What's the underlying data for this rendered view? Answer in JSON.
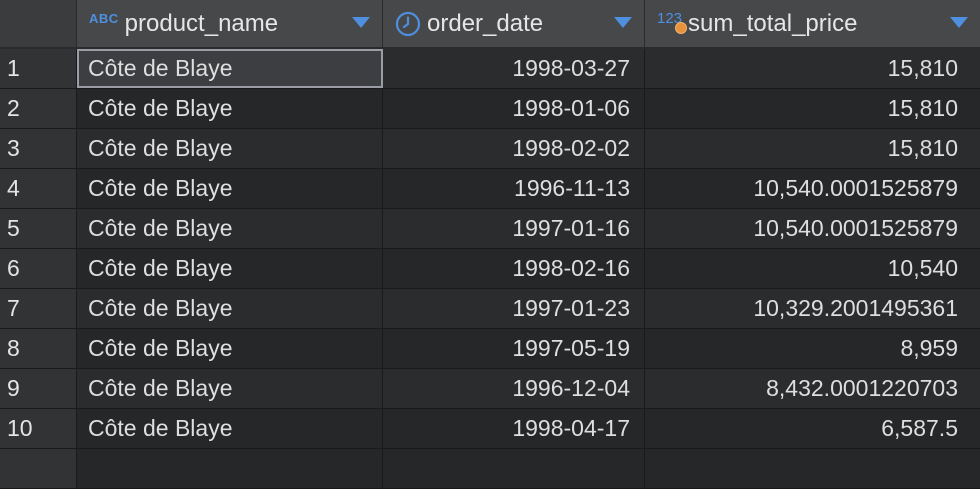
{
  "columns": [
    {
      "name": "product_name",
      "type_icon": "ABC",
      "icon_name": "text-type-icon"
    },
    {
      "name": "order_date",
      "type_icon": "",
      "icon_name": "clock-icon"
    },
    {
      "name": "sum_total_price",
      "type_icon": "123",
      "icon_name": "number-type-icon"
    }
  ],
  "rows": [
    {
      "n": "1",
      "product_name": "Côte de Blaye",
      "order_date": "1998-03-27",
      "sum_total_price": "15,810"
    },
    {
      "n": "2",
      "product_name": "Côte de Blaye",
      "order_date": "1998-01-06",
      "sum_total_price": "15,810"
    },
    {
      "n": "3",
      "product_name": "Côte de Blaye",
      "order_date": "1998-02-02",
      "sum_total_price": "15,810"
    },
    {
      "n": "4",
      "product_name": "Côte de Blaye",
      "order_date": "1996-11-13",
      "sum_total_price": "10,540.0001525879"
    },
    {
      "n": "5",
      "product_name": "Côte de Blaye",
      "order_date": "1997-01-16",
      "sum_total_price": "10,540.0001525879"
    },
    {
      "n": "6",
      "product_name": "Côte de Blaye",
      "order_date": "1998-02-16",
      "sum_total_price": "10,540"
    },
    {
      "n": "7",
      "product_name": "Côte de Blaye",
      "order_date": "1997-01-23",
      "sum_total_price": "10,329.2001495361"
    },
    {
      "n": "8",
      "product_name": "Côte de Blaye",
      "order_date": "1997-05-19",
      "sum_total_price": "8,959"
    },
    {
      "n": "9",
      "product_name": "Côte de Blaye",
      "order_date": "1996-12-04",
      "sum_total_price": "8,432.0001220703"
    },
    {
      "n": "10",
      "product_name": "Côte de Blaye",
      "order_date": "1998-04-17",
      "sum_total_price": "6,587.5"
    }
  ],
  "colors": {
    "accent": "#4f8fe0",
    "numeric_dot": "#e8923b",
    "header_bg": "#47484a",
    "row_bg_odd": "#2b2c2e",
    "row_bg_even": "#262729"
  }
}
